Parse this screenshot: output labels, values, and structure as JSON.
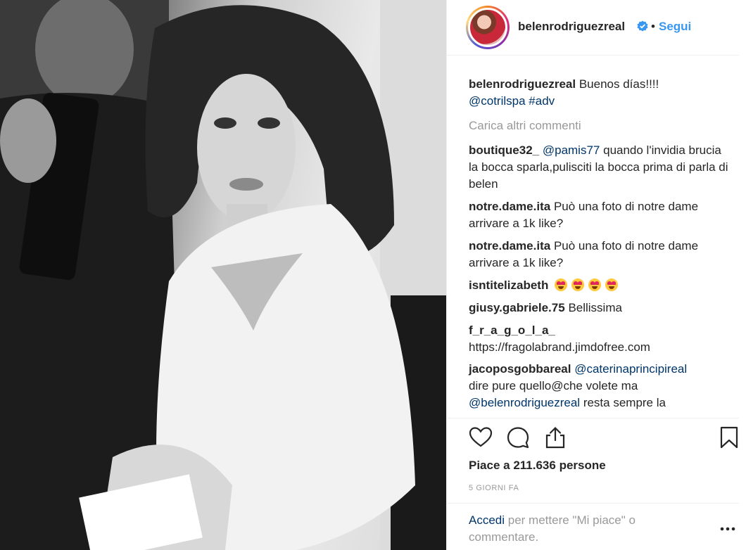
{
  "post": {
    "author": "belenrodriguezreal",
    "follow_label": "Segui",
    "separator": "•",
    "caption": {
      "user": "belenrodriguezreal",
      "text": "Buenos días!!!!",
      "mention": "@cotrilspa",
      "hashtag": "#adv"
    },
    "load_more": "Carica altri commenti",
    "comments": [
      {
        "user": "boutique32_",
        "mention": "@pamis77",
        "text": "quando l'invidia brucia la bocca sparla,pulisciti la bocca prima di parla di belen"
      },
      {
        "user": "notre.dame.ita",
        "text": "Può una foto di notre dame arrivare a 1k like?"
      },
      {
        "user": "notre.dame.ita",
        "text": "Può una foto di notre dame arrivare a 1k like?"
      },
      {
        "user": "isntitelizabeth",
        "text": "",
        "emoji_count": 4
      },
      {
        "user": "giusy.gabriele.75",
        "text": "Bellissima"
      },
      {
        "user": "f_r_a_g_o_l_a_",
        "text": "https://fragolabrand.jimdofree.com"
      },
      {
        "user": "jacoposgobbareal",
        "mention": "@caterinaprincipireal",
        "text": "dire pure quello@che volete ma",
        "mention2": "@belenrodriguezreal",
        "text2": "resta sempre la"
      }
    ],
    "likes": "Piace a 211.636 persone",
    "date": "5 GIORNI FA",
    "login": {
      "link": "Accedi",
      "text": "per mettere \"Mi piace\" o commentare."
    }
  },
  "colors": {
    "accent": "#3897f0",
    "link": "#003569",
    "muted": "#999999",
    "text": "#262626"
  },
  "icons": [
    "verified-badge-icon",
    "heart-icon",
    "comment-icon",
    "share-icon",
    "bookmark-icon",
    "more-options-icon"
  ]
}
